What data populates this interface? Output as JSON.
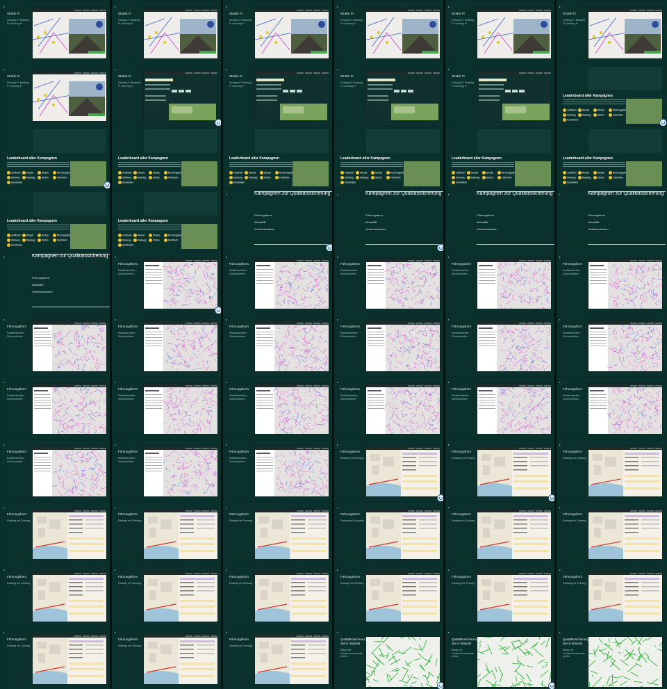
{
  "texts": {
    "mr_title": "Straße Fr",
    "mr_sub": "Gehweg Fr Radweg Fr Gehweg Fr",
    "leaderboard": "Leaderboard aller Kampagnen",
    "badges": [
      "verifiziert",
      "Aktuell",
      "Straße",
      "Richtungsfahrbahn",
      "Gehweg",
      "Radweg",
      "Stufen",
      "Fahrbahn",
      "Kombiniert"
    ],
    "campaign_title": "Kampagnen zur Qualitätssicherung",
    "campaign_links": [
      "Führungsform",
      "Aktualität",
      "Verkehrszeichen"
    ],
    "fuehrungsform": "Führungsform",
    "fuehrungsform_sub": "Radfahrstreifen · Schutzstreifen",
    "fuehrungsform_sub2": "Radweg mit Gehweg",
    "qual": "Qualitätssicherung durch AtlasSB",
    "qual_sub": "Wege mit Sonderstreckensatz prüfen"
  }
}
